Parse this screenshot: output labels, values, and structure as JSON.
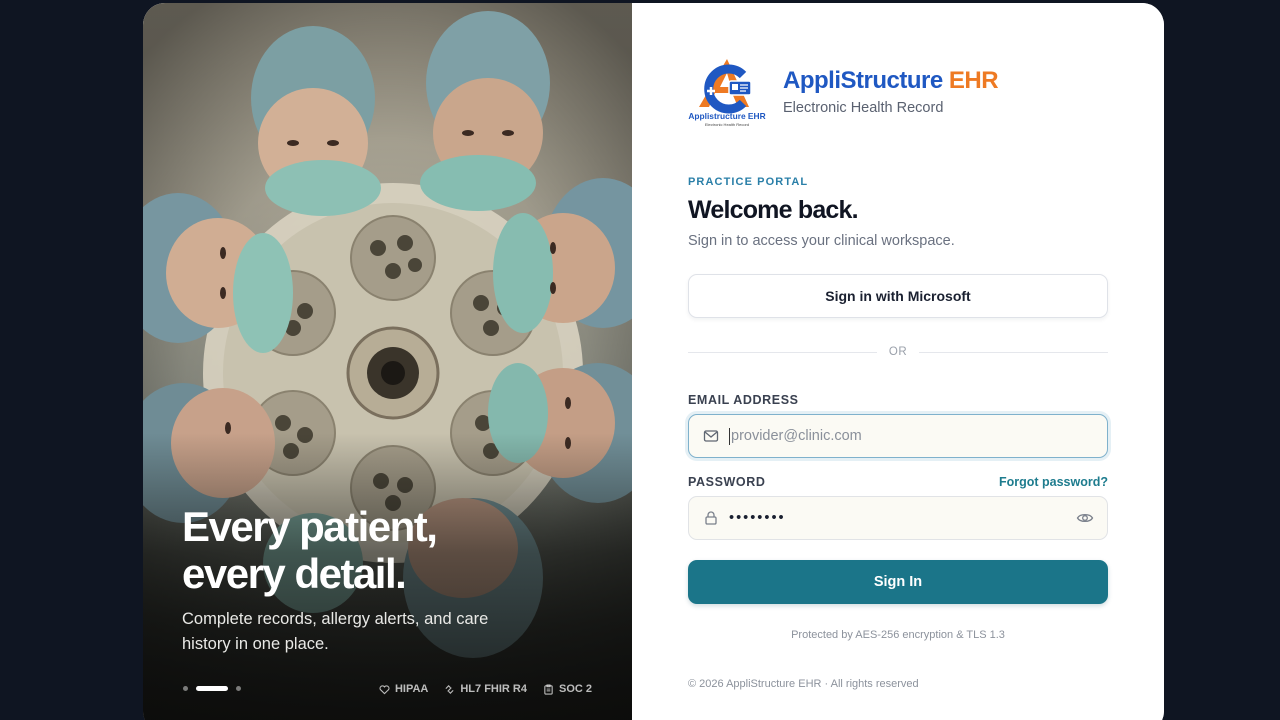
{
  "hero": {
    "headline_line1": "Every patient,",
    "headline_line2": "every detail.",
    "subtext": "Complete records, allergy alerts, and care history in one place.",
    "carousel": {
      "count": 3,
      "active_index": 1
    },
    "badges": [
      {
        "icon": "heart-icon",
        "label": "HIPAA"
      },
      {
        "icon": "link-icon",
        "label": "HL7 FHIR R4"
      },
      {
        "icon": "clipboard-icon",
        "label": "SOC 2"
      }
    ]
  },
  "brand": {
    "logo_text": "Applistructure EHR",
    "logo_tagline": "Electronic Health Record",
    "name_part1": "AppliStructure",
    "name_part2": " EHR",
    "tagline": "Electronic Health Record",
    "colors": {
      "blue": "#1f58c2",
      "orange": "#ee7a23"
    }
  },
  "form": {
    "eyebrow": "PRACTICE PORTAL",
    "heading": "Welcome back.",
    "lead": "Sign in to access your clinical workspace.",
    "microsoft_button": "Sign in with Microsoft",
    "divider": "OR",
    "email_label": "EMAIL ADDRESS",
    "email_placeholder": "provider@clinic.com",
    "email_value": "",
    "password_label": "PASSWORD",
    "forgot_link": "Forgot password?",
    "password_value": "password",
    "submit": "Sign In",
    "security_note": "Protected by AES-256 encryption & TLS 1.3",
    "copyright": "© 2026 AppliStructure EHR · All rights reserved",
    "accent_color": "#1b7589"
  }
}
